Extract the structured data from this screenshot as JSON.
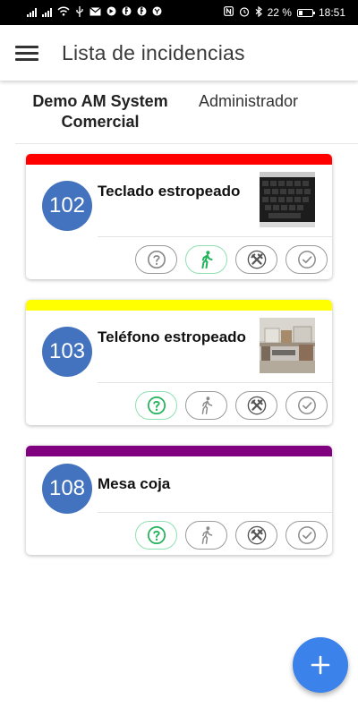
{
  "status_bar": {
    "battery": "22 %",
    "time": "18:51",
    "left_icons": [
      "signal-icon",
      "signal-icon",
      "wifi-icon",
      "usb-icon",
      "mail-icon",
      "notification-icon",
      "notification-icon",
      "notification-icon",
      "notification-icon"
    ],
    "right_icons": [
      "nfc-icon",
      "alarm-icon",
      "bluetooth-icon",
      "battery-icon"
    ]
  },
  "app_bar": {
    "title": "Lista de incidencias",
    "menu_icon": "hamburger-menu-icon"
  },
  "header": {
    "company": "Demo AM System Comercial",
    "role": "Administrador"
  },
  "colors": {
    "badge": "#4373bf",
    "active_action": "#22b35b",
    "inactive_action": "#8a8a8a",
    "fab": "#3b82ea"
  },
  "incidents": [
    {
      "number": "102",
      "title": "Teclado estropeado",
      "strip_color": "#ff0000",
      "has_photo": true,
      "photo": "keyboard-photo",
      "actions": [
        "question-icon",
        "walking-person-icon",
        "tools-icon",
        "check-circle-icon"
      ],
      "active_action": "walking-person-icon"
    },
    {
      "number": "103",
      "title": "Teléfono estropeado",
      "strip_color": "#ffff00",
      "has_photo": true,
      "photo": "office-photo",
      "actions": [
        "question-icon",
        "walking-person-icon",
        "tools-icon",
        "check-circle-icon"
      ],
      "active_action": "question-icon"
    },
    {
      "number": "108",
      "title": "Mesa coja",
      "strip_color": "#800080",
      "has_photo": false,
      "actions": [
        "question-icon",
        "walking-person-icon",
        "tools-icon",
        "check-circle-icon"
      ],
      "active_action": "question-icon"
    }
  ],
  "fab": {
    "icon": "plus-icon"
  }
}
